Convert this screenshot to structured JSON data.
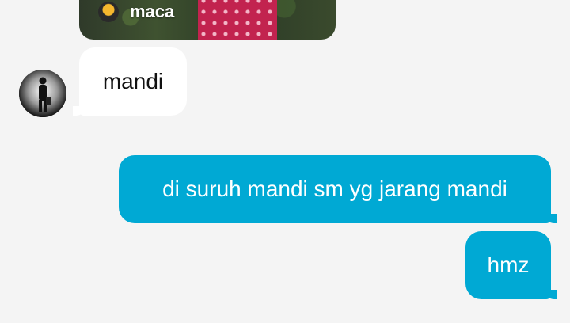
{
  "media_card": {
    "creator_name": "maca",
    "icon": "creator-icon"
  },
  "avatar": {
    "icon": "avatar-person-silhouette"
  },
  "messages": [
    {
      "direction": "incoming",
      "text": "mandi"
    },
    {
      "direction": "outgoing",
      "text": "di suruh mandi sm yg jarang mandi"
    },
    {
      "direction": "outgoing",
      "text": "hmz"
    }
  ],
  "colors": {
    "background": "#f4f4f4",
    "incoming_bubble": "#ffffff",
    "outgoing_bubble": "#00a9d4",
    "outgoing_text": "#ffffff"
  }
}
